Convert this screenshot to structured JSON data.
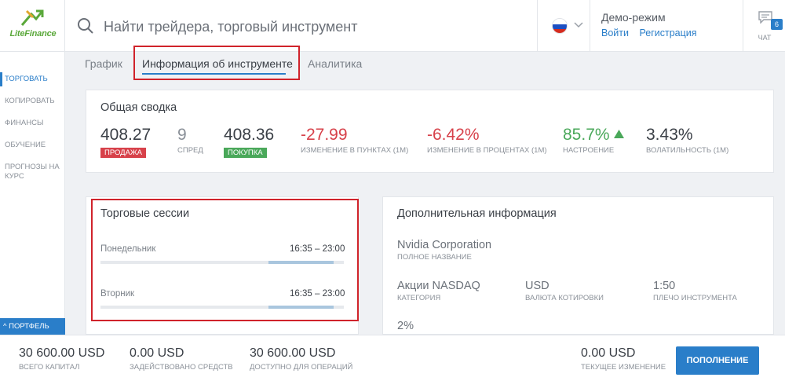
{
  "app": {
    "logo_text": "LiteFinance"
  },
  "header": {
    "search_placeholder": "Найти трейдера, торговый инструмент",
    "demo_title": "Демо-режим",
    "login": "Войти",
    "register": "Регистрация",
    "chat_label": "ЧАТ",
    "chat_count": "6"
  },
  "sidebar": {
    "items": [
      "ТОРГОВАТЬ",
      "КОПИРОВАТЬ",
      "ФИНАНСЫ",
      "ОБУЧЕНИЕ",
      "ПРОГНОЗЫ НА КУРС"
    ],
    "portfolio": "ПОРТФЕЛЬ"
  },
  "tabs": [
    "График",
    "Информация об инструменте",
    "Аналитика"
  ],
  "summary": {
    "title": "Общая сводка",
    "sell_price": "408.27",
    "sell_label": "ПРОДАЖА",
    "spread": "9",
    "spread_label": "СПРЕД",
    "buy_price": "408.36",
    "buy_label": "ПОКУПКА",
    "change_points": "-27.99",
    "change_points_label": "ИЗМЕНЕНИЕ В ПУНКТАХ (1М)",
    "change_percent": "-6.42%",
    "change_percent_label": "ИЗМЕНЕНИЕ В ПРОЦЕНТАХ (1М)",
    "sentiment": "85.7%",
    "sentiment_label": "НАСТРОЕНИЕ",
    "volatility": "3.43%",
    "volatility_label": "ВОЛАТИЛЬНОСТЬ (1М)"
  },
  "sessions": {
    "title": "Торговые сессии",
    "days": [
      {
        "day": "Понедельник",
        "time": "16:35 – 23:00"
      },
      {
        "day": "Вторник",
        "time": "16:35 – 23:00"
      }
    ]
  },
  "additional": {
    "title": "Дополнительная информация",
    "full_name": "Nvidia Corporation",
    "full_name_label": "ПОЛНОЕ НАЗВАНИЕ",
    "category": "Акции NASDAQ",
    "category_label": "КАТЕГОРИЯ",
    "currency": "USD",
    "currency_label": "ВАЛЮТА КОТИРОВКИ",
    "leverage": "1:50",
    "leverage_label": "ПЛЕЧО ИНСТРУМЕНТА",
    "extra": "2%"
  },
  "footer": {
    "total_capital": "30 600.00 USD",
    "total_capital_label": "ВСЕГО КАПИТАЛ",
    "used_funds": "0.00 USD",
    "used_funds_label": "ЗАДЕЙСТВОВАНО СРЕДСТВ",
    "available": "30 600.00 USD",
    "available_label": "ДОСТУПНО ДЛЯ ОПЕРАЦИЙ",
    "current_change": "0.00 USD",
    "current_change_label": "ТЕКУЩЕЕ ИЗМЕНЕНИЕ",
    "deposit": "ПОПОЛНЕНИЕ"
  },
  "colors": {
    "accent": "#2a7ec9",
    "negative": "#d7414a",
    "positive": "#4aa85a",
    "highlight": "#d0232b"
  }
}
